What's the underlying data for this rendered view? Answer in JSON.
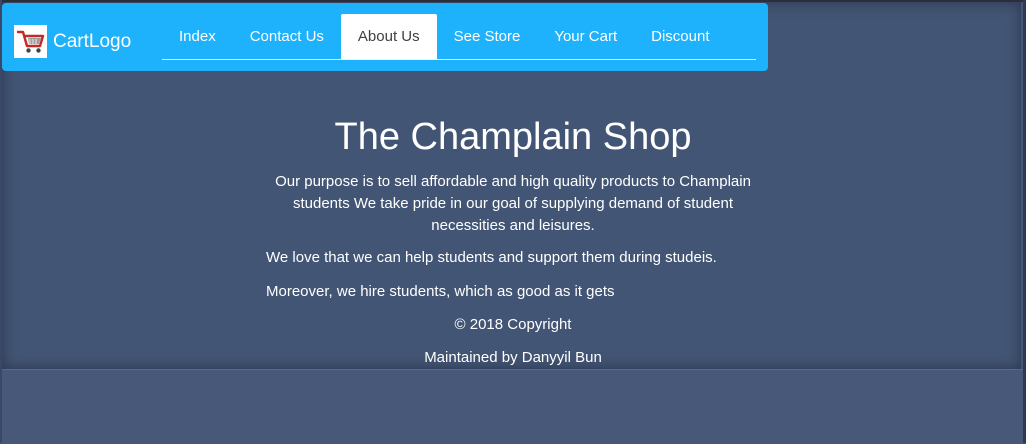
{
  "brand": {
    "name": "CartLogo",
    "logo_icon": "shopping-cart-icon",
    "color": "#1eb1fc"
  },
  "nav": {
    "items": [
      {
        "label": "Index",
        "active": false
      },
      {
        "label": "Contact Us",
        "active": false
      },
      {
        "label": "About Us",
        "active": true
      },
      {
        "label": "See Store",
        "active": false
      },
      {
        "label": "Your Cart",
        "active": false
      },
      {
        "label": "Discount",
        "active": false
      }
    ]
  },
  "main": {
    "title": "The Champlain Shop",
    "purpose": "Our purpose is to sell affordable and high quality products to Champlain students We take pride in our goal of supplying demand of student necessities and leisures.",
    "paragraph_1": "We love that we can help students and support them during studeis.",
    "paragraph_2": "Moreover, we hire students, which as good as it gets"
  },
  "footer": {
    "copyright": "© 2018 Copyright",
    "maintainer": "Maintained by Danyyil Bun"
  },
  "colors": {
    "background": "#455677",
    "nav_background": "#1eb1fc",
    "active_tab_background": "#ffffff",
    "text": "#ffffff"
  }
}
